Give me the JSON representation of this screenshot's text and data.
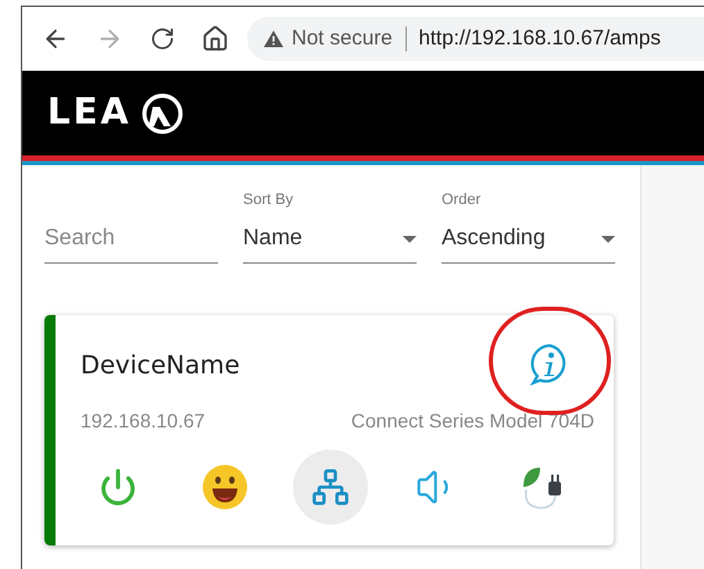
{
  "browser": {
    "security": "Not secure",
    "url": "http://192.168.10.67/amps"
  },
  "header": {
    "logo": "LEA"
  },
  "filters": {
    "search": {
      "placeholder": "Search"
    },
    "sort": {
      "label": "Sort By",
      "value": "Name"
    },
    "order": {
      "label": "Order",
      "value": "Ascending"
    }
  },
  "device": {
    "name": "DeviceName",
    "ip": "192.168.10.67",
    "model": "Connect Series Model 704D",
    "actions": [
      {
        "kind": "power",
        "selected": false
      },
      {
        "kind": "status",
        "selected": false
      },
      {
        "kind": "network",
        "selected": true
      },
      {
        "kind": "audio",
        "selected": false
      },
      {
        "kind": "eco",
        "selected": false
      }
    ]
  }
}
